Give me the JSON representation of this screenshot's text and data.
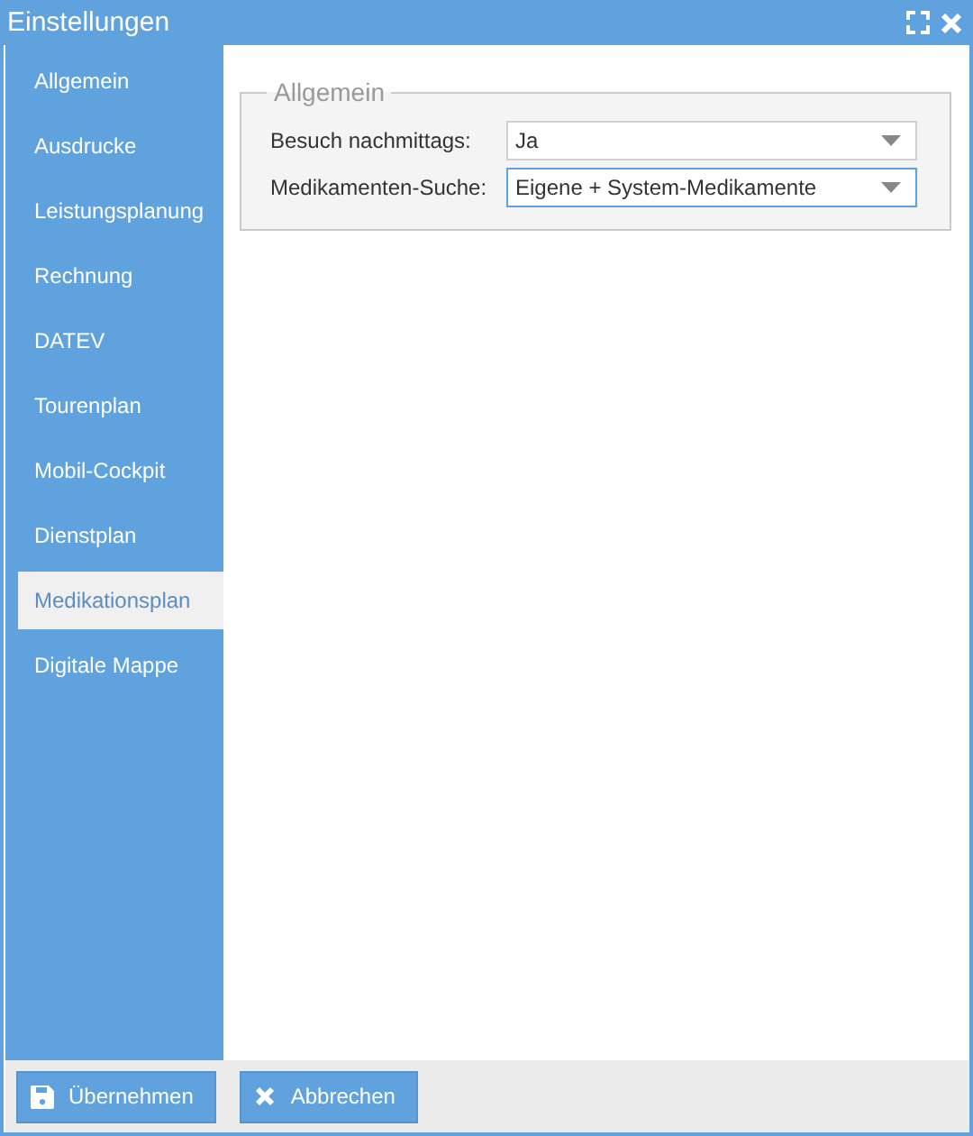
{
  "window": {
    "title": "Einstellungen"
  },
  "sidebar": {
    "items": [
      {
        "label": "Allgemein",
        "selected": false
      },
      {
        "label": "Ausdrucke",
        "selected": false
      },
      {
        "label": "Leistungsplanung",
        "selected": false
      },
      {
        "label": "Rechnung",
        "selected": false
      },
      {
        "label": "DATEV",
        "selected": false
      },
      {
        "label": "Tourenplan",
        "selected": false
      },
      {
        "label": "Mobil-Cockpit",
        "selected": false
      },
      {
        "label": "Dienstplan",
        "selected": false
      },
      {
        "label": "Medikationsplan",
        "selected": true
      },
      {
        "label": "Digitale Mappe",
        "selected": false
      }
    ]
  },
  "group": {
    "legend": "Allgemein",
    "fields": [
      {
        "label": "Besuch nachmittags:",
        "value": "Ja",
        "focused": false
      },
      {
        "label": "Medikamenten-Suche:",
        "value": "Eigene + System-Medikamente",
        "focused": true
      }
    ]
  },
  "buttons": [
    {
      "kind": "save",
      "label": "Übernehmen"
    },
    {
      "kind": "cancel",
      "label": "Abbrechen"
    }
  ]
}
